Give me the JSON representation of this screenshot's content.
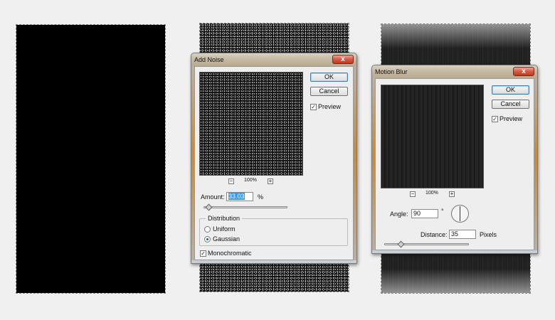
{
  "add_noise": {
    "title": "Add Noise",
    "close": "x",
    "ok_label": "OK",
    "cancel_label": "Cancel",
    "preview_label": "Preview",
    "preview_checked": "✓",
    "zoom_out": "−",
    "zoom_level": "100%",
    "zoom_in": "+",
    "amount_label": "Amount:",
    "amount_value": "33.03",
    "amount_unit": "%",
    "amount_slider_fraction": 0.03,
    "distribution_label": "Distribution",
    "uniform_label": "Uniform",
    "gaussian_label": "Gaussian",
    "selected_distribution": "Gaussian",
    "monochromatic_label": "Monochromatic",
    "monochromatic_checked": "✓"
  },
  "motion_blur": {
    "title": "Motion Blur",
    "close": "x",
    "ok_label": "OK",
    "cancel_label": "Cancel",
    "preview_label": "Preview",
    "preview_checked": "✓",
    "zoom_out": "−",
    "zoom_level": "100%",
    "zoom_in": "+",
    "angle_label": "Angle:",
    "angle_value": "90",
    "angle_unit": "°",
    "distance_label": "Distance:",
    "distance_value": "35",
    "distance_unit": "Pixels",
    "distance_slider_fraction": 0.17
  },
  "colors": {
    "canvas_black": "#000000",
    "default_button_border": "#3c7fb1",
    "close_button": "#d35a44"
  }
}
